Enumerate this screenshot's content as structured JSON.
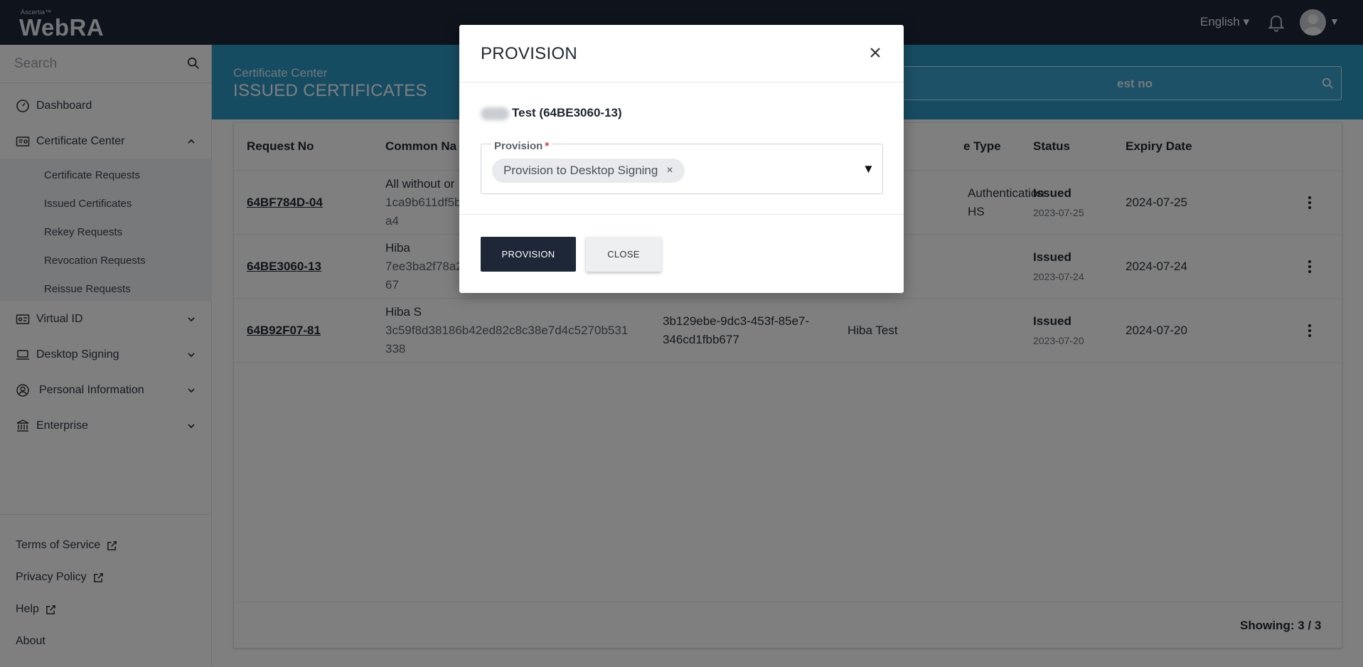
{
  "app": {
    "brand_small": "Ascertia™",
    "brand_main": "WebRA",
    "language": "English ▾"
  },
  "sidebar": {
    "search_placeholder": "Search",
    "items": [
      {
        "label": "Dashboard",
        "icon": "dashboard-icon"
      },
      {
        "label": "Certificate Center",
        "icon": "certificate-icon",
        "expanded": true
      },
      {
        "label": "Virtual ID",
        "icon": "id-card-icon"
      },
      {
        "label": "Desktop Signing",
        "icon": "laptop-icon"
      },
      {
        "label": "Personal Information",
        "icon": "user-circle-icon"
      },
      {
        "label": "Enterprise",
        "icon": "bank-icon"
      }
    ],
    "submenu": [
      "Certificate Requests",
      "Issued Certificates",
      "Rekey Requests",
      "Revocation Requests",
      "Reissue Requests"
    ],
    "footer_links": [
      {
        "label": "Terms of Service",
        "external": true
      },
      {
        "label": "Privacy Policy",
        "external": true
      },
      {
        "label": "Help",
        "external": true
      },
      {
        "label": "About",
        "external": false
      }
    ]
  },
  "header": {
    "breadcrumb": "Certificate Center",
    "title": "ISSUED CERTIFICATES",
    "search_placeholder": "est no"
  },
  "table": {
    "columns": [
      "Request No",
      "Common Na",
      "",
      "e Type",
      "Status",
      "Expiry Date"
    ],
    "rows": [
      {
        "request_no": "64BF784D-04",
        "common_name": "All without or",
        "common_sub1": "1ca9b611df5b",
        "common_sub2": "a4",
        "col3_line1": "",
        "col3_line2": "",
        "type_line1": "Authentication",
        "type_line2": "HS",
        "status": "Issued",
        "status_date": "2023-07-25",
        "expiry": "2024-07-25"
      },
      {
        "request_no": "64BE3060-13",
        "common_name": "Hiba",
        "common_sub1": "7ee3ba2f78a2",
        "common_sub2": "67",
        "col3_line1": "",
        "col3_line2": "",
        "type_line1": "",
        "type_line2": "",
        "status": "Issued",
        "status_date": "2023-07-24",
        "expiry": "2024-07-24"
      },
      {
        "request_no": "64B92F07-81",
        "common_name": "Hiba S",
        "common_sub1": "3c59f8d38186b42ed82c8c38e7d4c5270b531",
        "common_sub2": "338",
        "col3_line1": "3b129ebe-9dc3-453f-85e7-",
        "col3_line2": "346cd1fbb677",
        "type_line1": "Hiba Test",
        "type_line2": "",
        "status": "Issued",
        "status_date": "2023-07-20",
        "expiry": "2024-07-20"
      }
    ],
    "showing": "Showing:  3 / 3"
  },
  "modal": {
    "title": "PROVISION",
    "cert_name": "Test (64BE3060-13)",
    "field_label": "Provision",
    "required_mark": "*",
    "selected_chip": "Provision to Desktop Signing",
    "chip_remove": "×",
    "caret": "▼",
    "primary_button": "PROVISION",
    "secondary_button": "CLOSE"
  },
  "colors": {
    "topbar": "#1d2738",
    "header_band": "#2d98c5",
    "primary_button": "#1d2738",
    "required": "#d9323a"
  }
}
